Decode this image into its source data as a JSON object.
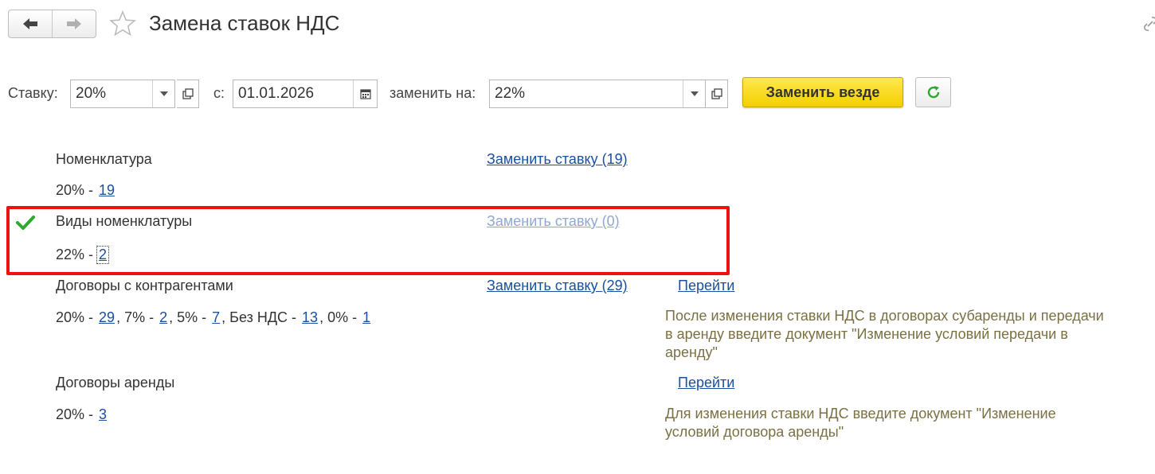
{
  "header": {
    "title": "Замена ставок НДС",
    "back_icon": "arrow-left-icon",
    "forward_icon": "arrow-right-icon",
    "favorite_icon": "star-icon",
    "link_icon": "link-icon"
  },
  "toolbar": {
    "rate_label": "Ставку:",
    "rate_value": "20%",
    "date_label": "с:",
    "date_value": "01.01.2026",
    "replace_label": "заменить на:",
    "replace_value": "22%",
    "replace_all_button": "Заменить везде",
    "refresh_icon": "refresh-icon"
  },
  "colors": {
    "link": "#1b4fa0",
    "link_disabled": "#8fa8d0",
    "note": "#7a7043",
    "highlight": "#ee1111",
    "accent_button": "#f4cf00",
    "check": "#2fa82f"
  },
  "sections": [
    {
      "title": "Номенклатура",
      "action": "Заменить ставку (19)",
      "rates": [
        {
          "rate": "20%",
          "count": "19"
        }
      ]
    },
    {
      "title": "Виды номенклатуры",
      "action": "Заменить ставку (0)",
      "done": true,
      "rates": [
        {
          "rate": "22%",
          "count": "2"
        }
      ]
    },
    {
      "title": "Договоры с контрагентами",
      "action": "Заменить ставку (29)",
      "go": "Перейти",
      "rates": [
        {
          "rate": "20%",
          "count": "29"
        },
        {
          "rate": "7%",
          "count": "2"
        },
        {
          "rate": "5%",
          "count": "7"
        },
        {
          "rate": "Без НДС",
          "count": "13"
        },
        {
          "rate": "0%",
          "count": "1"
        }
      ],
      "note": "После изменения ставки НДС в договорах субаренды и передачи в аренду введите документ \"Изменение условий передачи в аренду\""
    },
    {
      "title": "Договоры аренды",
      "go": "Перейти",
      "rates": [
        {
          "rate": "20%",
          "count": "3"
        }
      ],
      "note": "Для изменения ставки НДС введите документ \"Изменение условий договора аренды\""
    }
  ]
}
